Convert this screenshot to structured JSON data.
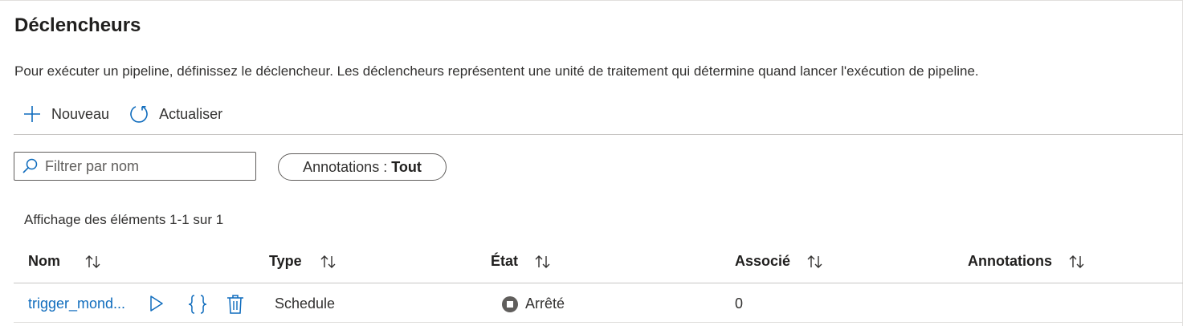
{
  "page": {
    "title": "Déclencheurs",
    "description": "Pour exécuter un pipeline, définissez le déclencheur. Les déclencheurs représentent une unité de traitement qui détermine quand lancer l'exécution de pipeline."
  },
  "toolbar": {
    "new_label": "Nouveau",
    "new_icon": "plus-icon",
    "refresh_label": "Actualiser",
    "refresh_icon": "refresh-icon"
  },
  "filter": {
    "search_placeholder": "Filtrer par nom",
    "search_value": "",
    "annotations_label": "Annotations :",
    "annotations_value": "Tout"
  },
  "table": {
    "count_text": "Affichage des éléments 1-1 sur 1",
    "columns": [
      "Nom",
      "Type",
      "État",
      "Associé",
      "Annotations"
    ],
    "rows": [
      {
        "name": "trigger_mond...",
        "type": "Schedule",
        "state": "Arrêté",
        "associated": "0",
        "annotations": ""
      }
    ]
  },
  "colors": {
    "accent": "#0f6cbd",
    "text": "#323130",
    "border": "#605e5c",
    "stopped_status": "#605e5c"
  }
}
